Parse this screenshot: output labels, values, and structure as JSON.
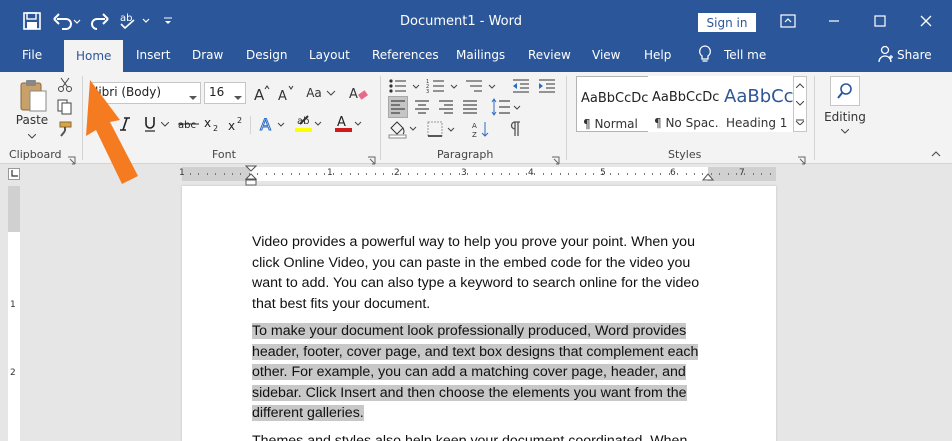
{
  "window": {
    "title": "Document1 - Word",
    "sign_in": "Sign in"
  },
  "tabs": [
    {
      "label": "File"
    },
    {
      "label": "Home"
    },
    {
      "label": "Insert"
    },
    {
      "label": "Draw"
    },
    {
      "label": "Design"
    },
    {
      "label": "Layout"
    },
    {
      "label": "References"
    },
    {
      "label": "Mailings"
    },
    {
      "label": "Review"
    },
    {
      "label": "View"
    },
    {
      "label": "Help"
    },
    {
      "label": "Tell me"
    },
    {
      "label": "Share"
    }
  ],
  "clipboard": {
    "paste": "Paste",
    "label": "Clipboard"
  },
  "font": {
    "name": "libri (Body)",
    "size": "16",
    "label": "Font",
    "change_case": "Aa"
  },
  "paragraph": {
    "label": "Paragraph"
  },
  "styles": {
    "label": "Styles",
    "items": [
      {
        "sample": "AaBbCcDc",
        "name": "¶ Normal"
      },
      {
        "sample": "AaBbCcDc",
        "name": "¶ No Spac..."
      },
      {
        "sample": "AaBbCc",
        "name": "Heading 1"
      }
    ]
  },
  "editing": {
    "label": "Editing"
  },
  "ruler": {
    "numbers": [
      "1",
      "1",
      "2",
      "3",
      "4",
      "5",
      "6",
      "7"
    ]
  },
  "vruler": {
    "numbers": [
      "1",
      "2"
    ]
  },
  "document": {
    "paragraph1": [
      "Video provides a powerful way to help you prove your point. When you",
      "click Online Video, you can paste in the embed code for the video you",
      "want to add. You can also type a keyword to search online for the video",
      "that best fits your document."
    ],
    "paragraph2": [
      "To make your document look professionally produced, Word provides",
      "header, footer, cover page, and text box designs that complement each",
      "other. For example, you can add a matching cover page, header, and",
      "sidebar. Click Insert and then choose the elements you want from the",
      "different galleries."
    ],
    "paragraph3": [
      "Themes and styles also help keep your document coordinated. When"
    ]
  },
  "colors": {
    "title_bar": "#2b579a",
    "ribbon": "#f3f3f3",
    "highlight": "#c8c8c8",
    "arrow": "#f47b20"
  }
}
